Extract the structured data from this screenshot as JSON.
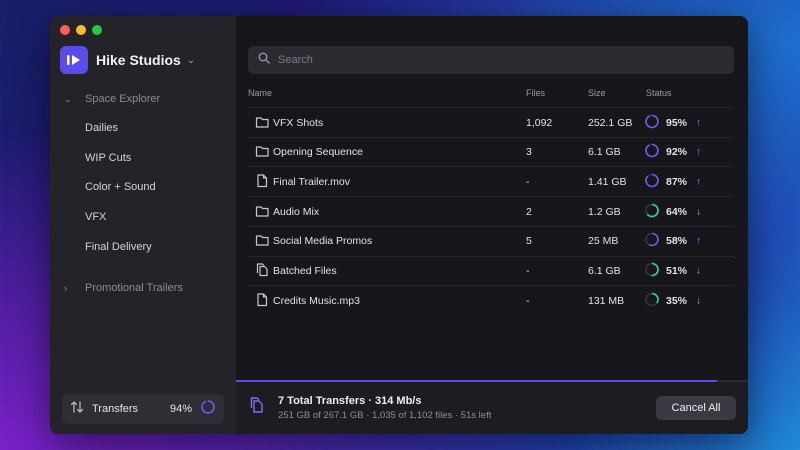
{
  "brand": {
    "name": "Hike Studios",
    "accent": "#5b4be8"
  },
  "sidebar": {
    "section_expanded": "Space Explorer",
    "items": [
      "Dailies",
      "WIP Cuts",
      "Color + Sound",
      "VFX",
      "Final Delivery"
    ],
    "section_collapsed": "Promotional Trailers",
    "transfers": {
      "label": "Transfers",
      "percent": "94%",
      "progress": 0.94
    }
  },
  "search": {
    "placeholder": "Search"
  },
  "table": {
    "columns": {
      "name": "Name",
      "files": "Files",
      "size": "Size",
      "status": "Status"
    },
    "rows": [
      {
        "icon": "folder-icon",
        "name": "VFX Shots",
        "files": "1,092",
        "size": "252.1 GB",
        "percent": "95%",
        "progress": 0.95,
        "direction": "up"
      },
      {
        "icon": "folder-icon",
        "name": "Opening Sequence",
        "files": "3",
        "size": "6.1 GB",
        "percent": "92%",
        "progress": 0.92,
        "direction": "up"
      },
      {
        "icon": "file-icon",
        "name": "Final Trailer.mov",
        "files": "-",
        "size": "1.41 GB",
        "percent": "87%",
        "progress": 0.87,
        "direction": "up"
      },
      {
        "icon": "folder-icon",
        "name": "Audio Mix",
        "files": "2",
        "size": "1.2 GB",
        "percent": "64%",
        "progress": 0.64,
        "direction": "down"
      },
      {
        "icon": "folder-icon",
        "name": "Social Media Promos",
        "files": "5",
        "size": "25 MB",
        "percent": "58%",
        "progress": 0.58,
        "direction": "up"
      },
      {
        "icon": "files-icon",
        "name": "Batched Files",
        "files": "-",
        "size": "6.1 GB",
        "percent": "51%",
        "progress": 0.51,
        "direction": "down"
      },
      {
        "icon": "file-icon",
        "name": "Credits Music.mp3",
        "files": "-",
        "size": "131 MB",
        "percent": "35%",
        "progress": 0.35,
        "direction": "down"
      }
    ]
  },
  "footer": {
    "title": "7 Total Transfers  ·  314 Mb/s",
    "subtitle": "251 GB of 267.1 GB  ·  1,035 of 1,102 files  ·  51s left",
    "cancel_label": "Cancel All",
    "progress": 0.94
  },
  "colors": {
    "upload": "#8e7bff",
    "download": "#2ed3a3",
    "upload_ring": "#6a5cf0",
    "download_ring": "#2ed3a3"
  }
}
